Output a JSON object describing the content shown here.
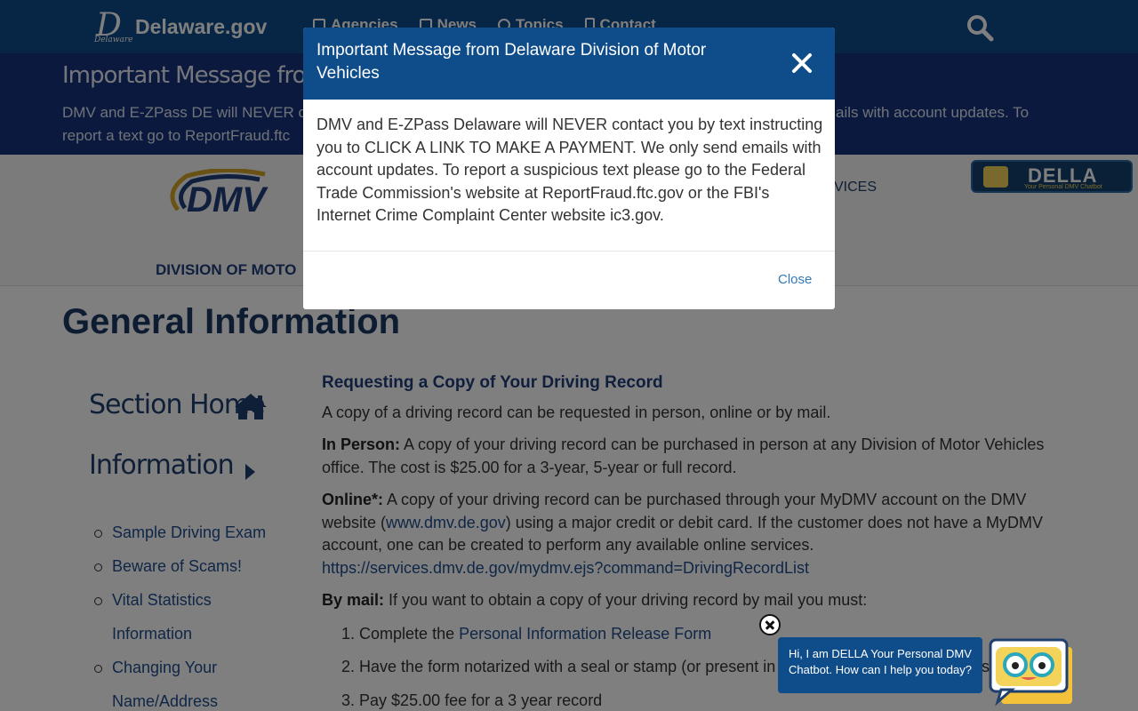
{
  "topbar": {
    "logo_letter": "D",
    "logo_sub": "Delaware",
    "logo_text": "Delaware.gov",
    "nav": [
      {
        "label": "Agencies"
      },
      {
        "label": "News"
      },
      {
        "label": "Topics"
      },
      {
        "label": "Contact"
      }
    ]
  },
  "alert": {
    "title": "Important Message from De",
    "body_left_1": "DMV and E-ZPass DE will NEVER c",
    "body_right_1": "ails with account updates. To",
    "body_left_2": "report a text go to ReportFraud.ftc"
  },
  "header": {
    "dmv_logo": "DMV",
    "services_fragment": "VICES",
    "della_title": "DELLA",
    "della_sub": "Your Personal DMV Chatbot",
    "division": "DIVISION OF MOTO"
  },
  "page": {
    "title": "General Information"
  },
  "sidebar": {
    "home_label": "Section Home",
    "info_label": "Information",
    "links": [
      {
        "label": "Sample Driving Exam"
      },
      {
        "label": "Beware of Scams!"
      },
      {
        "label": "Vital Statistics"
      },
      {
        "label": "Information"
      },
      {
        "label": "Changing Your"
      },
      {
        "label": "Name/Address"
      }
    ]
  },
  "content": {
    "heading": "Requesting a Copy of Your Driving Record",
    "intro": "A copy of a driving record can be requested in person, online or by mail.",
    "in_person_label": "In Person:",
    "in_person_text": " A copy of your driving record can be purchased in person at any Division of Motor Vehicles office. The cost is $25.00 for a 3-year, 5-year or full record.",
    "online_label": "Online*:",
    "online_text_1": " A copy of your driving record can be purchased through your MyDMV account on the DMV website (",
    "online_link": "www.dmv.de.gov",
    "online_text_2": ") using a major credit or debit card. If the customer does not have a MyDMV account, one can be created to perform any available online services.",
    "online_url": "https://services.dmv.de.gov/mydmv.ejs?command=DrivingRecordList",
    "mail_label": "By mail:",
    "mail_text": " If you want to obtain a copy of your driving record by mail you must:",
    "steps": [
      {
        "num": "1.",
        "text": "Complete the ",
        "link": "Personal Information Release Form"
      },
      {
        "num": "2.",
        "text": "Have the form notarized with a seal or stamp (or present in",
        "link": ""
      },
      {
        "num": "3.",
        "text": "Pay $25.00 fee for a 3 year record",
        "link": ""
      }
    ],
    "step2_tail": "s)"
  },
  "modal": {
    "title": "Important Message from Delaware Division of Motor Vehicles",
    "body": "DMV and E-ZPass Delaware will NEVER contact you by text instructing you to CLICK A LINK TO MAKE A PAYMENT. We only send emails with account updates. To report a suspicious text please go to the Federal Trade Commission's website at ReportFraud.ftc.gov or the FBI's Internet Crime Complaint Center website ic3.gov.",
    "close_label": "Close"
  },
  "chat": {
    "message": "Hi, I am DELLA Your Personal DMV Chatbot. How can I help you today?"
  },
  "colors": {
    "brand_blue": "#0f4c8a",
    "alert_navy": "#14337a",
    "link_blue": "#337ab7",
    "heading_navy": "#1c3964"
  }
}
